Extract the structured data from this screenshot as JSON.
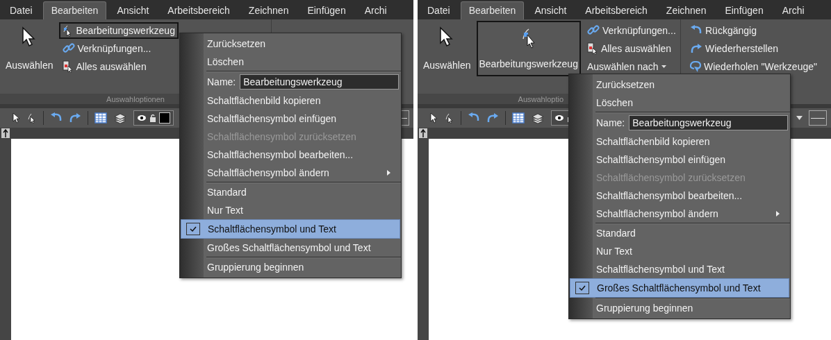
{
  "panels": [
    {
      "menubar": [
        {
          "label": "Datei",
          "selected": false
        },
        {
          "label": "Bearbeiten",
          "selected": true
        },
        {
          "label": "Ansicht",
          "selected": false
        },
        {
          "label": "Arbeitsbereich",
          "selected": false
        },
        {
          "label": "Zeichnen",
          "selected": false
        },
        {
          "label": "Einfügen",
          "selected": false
        },
        {
          "label": "Archi",
          "selected": false
        }
      ],
      "ribbon": {
        "select": {
          "label": "Auswählen"
        },
        "edit_tool": {
          "label": "Bearbeitungswerkzeug",
          "kind": "small",
          "selected": true
        },
        "links": {
          "label": "Verknüpfungen..."
        },
        "select_all": {
          "label": "Alles auswählen"
        },
        "group_label": "Auswahloptionen"
      },
      "menu": {
        "items": [
          {
            "kind": "item",
            "label": "Zurücksetzen",
            "disabled": false,
            "checked": false,
            "selected": false,
            "submenu": false
          },
          {
            "kind": "item",
            "label": "Löschen",
            "disabled": false,
            "checked": false,
            "selected": false,
            "submenu": false
          },
          {
            "kind": "separator"
          },
          {
            "kind": "name_field",
            "label": "Name:",
            "value": "Bearbeitungswerkzeug"
          },
          {
            "kind": "item",
            "label": "Schaltflächenbild kopieren",
            "disabled": false,
            "checked": false,
            "selected": false,
            "submenu": false
          },
          {
            "kind": "item",
            "label": "Schaltflächensymbol einfügen",
            "disabled": false,
            "checked": false,
            "selected": false,
            "submenu": false
          },
          {
            "kind": "item",
            "label": "Schaltflächensymbol zurücksetzen",
            "disabled": true,
            "checked": false,
            "selected": false,
            "submenu": false
          },
          {
            "kind": "item",
            "label": "Schaltflächensymbol bearbeiten...",
            "disabled": false,
            "checked": false,
            "selected": false,
            "submenu": false
          },
          {
            "kind": "item",
            "label": "Schaltflächensymbol ändern",
            "disabled": false,
            "checked": false,
            "selected": false,
            "submenu": true
          },
          {
            "kind": "separator"
          },
          {
            "kind": "item",
            "label": "Standard",
            "disabled": false,
            "checked": false,
            "selected": false,
            "submenu": false
          },
          {
            "kind": "item",
            "label": "Nur Text",
            "disabled": false,
            "checked": false,
            "selected": false,
            "submenu": false
          },
          {
            "kind": "item",
            "label": "Schaltflächensymbol und Text",
            "disabled": false,
            "checked": true,
            "selected": true,
            "submenu": false
          },
          {
            "kind": "item",
            "label": "Großes Schaltflächensymbol und Text",
            "disabled": false,
            "checked": false,
            "selected": false,
            "submenu": false
          },
          {
            "kind": "separator"
          },
          {
            "kind": "item",
            "label": "Gruppierung beginnen",
            "disabled": false,
            "checked": false,
            "selected": false,
            "submenu": false
          }
        ]
      }
    },
    {
      "menubar": [
        {
          "label": "Datei",
          "selected": false
        },
        {
          "label": "Bearbeiten",
          "selected": true
        },
        {
          "label": "Ansicht",
          "selected": false
        },
        {
          "label": "Arbeitsbereich",
          "selected": false
        },
        {
          "label": "Zeichnen",
          "selected": false
        },
        {
          "label": "Einfügen",
          "selected": false
        },
        {
          "label": "Archi",
          "selected": false
        }
      ],
      "ribbon": {
        "select": {
          "label": "Auswählen"
        },
        "edit_tool": {
          "label": "Bearbeitungswerkzeug",
          "kind": "large",
          "selected": true
        },
        "links": {
          "label": "Verknüpfungen..."
        },
        "select_all": {
          "label": "Alles auswählen"
        },
        "select_by": {
          "label": "Auswählen nach"
        },
        "undo": {
          "label": "Rückgängig"
        },
        "redo": {
          "label": "Wiederherstellen"
        },
        "repeat": {
          "label": "Wiederholen \"Werkzeuge\""
        },
        "group_label": "Auswahloptio"
      },
      "menu": {
        "items": [
          {
            "kind": "item",
            "label": "Zurücksetzen",
            "disabled": false,
            "checked": false,
            "selected": false,
            "submenu": false
          },
          {
            "kind": "item",
            "label": "Löschen",
            "disabled": false,
            "checked": false,
            "selected": false,
            "submenu": false
          },
          {
            "kind": "separator"
          },
          {
            "kind": "name_field",
            "label": "Name:",
            "value": "Bearbeitungswerkzeug"
          },
          {
            "kind": "item",
            "label": "Schaltflächenbild kopieren",
            "disabled": false,
            "checked": false,
            "selected": false,
            "submenu": false
          },
          {
            "kind": "item",
            "label": "Schaltflächensymbol einfügen",
            "disabled": false,
            "checked": false,
            "selected": false,
            "submenu": false
          },
          {
            "kind": "item",
            "label": "Schaltflächensymbol zurücksetzen",
            "disabled": true,
            "checked": false,
            "selected": false,
            "submenu": false
          },
          {
            "kind": "item",
            "label": "Schaltflächensymbol bearbeiten...",
            "disabled": false,
            "checked": false,
            "selected": false,
            "submenu": false
          },
          {
            "kind": "item",
            "label": "Schaltflächensymbol ändern",
            "disabled": false,
            "checked": false,
            "selected": false,
            "submenu": true
          },
          {
            "kind": "separator"
          },
          {
            "kind": "item",
            "label": "Standard",
            "disabled": false,
            "checked": false,
            "selected": false,
            "submenu": false
          },
          {
            "kind": "item",
            "label": "Nur Text",
            "disabled": false,
            "checked": false,
            "selected": false,
            "submenu": false
          },
          {
            "kind": "item",
            "label": "Schaltflächensymbol und Text",
            "disabled": false,
            "checked": false,
            "selected": false,
            "submenu": false
          },
          {
            "kind": "item",
            "label": "Großes Schaltflächensymbol und Text",
            "disabled": false,
            "checked": true,
            "selected": true,
            "submenu": false
          },
          {
            "kind": "separator"
          },
          {
            "kind": "item",
            "label": "Gruppierung beginnen",
            "disabled": false,
            "checked": false,
            "selected": false,
            "submenu": false
          }
        ]
      }
    }
  ]
}
